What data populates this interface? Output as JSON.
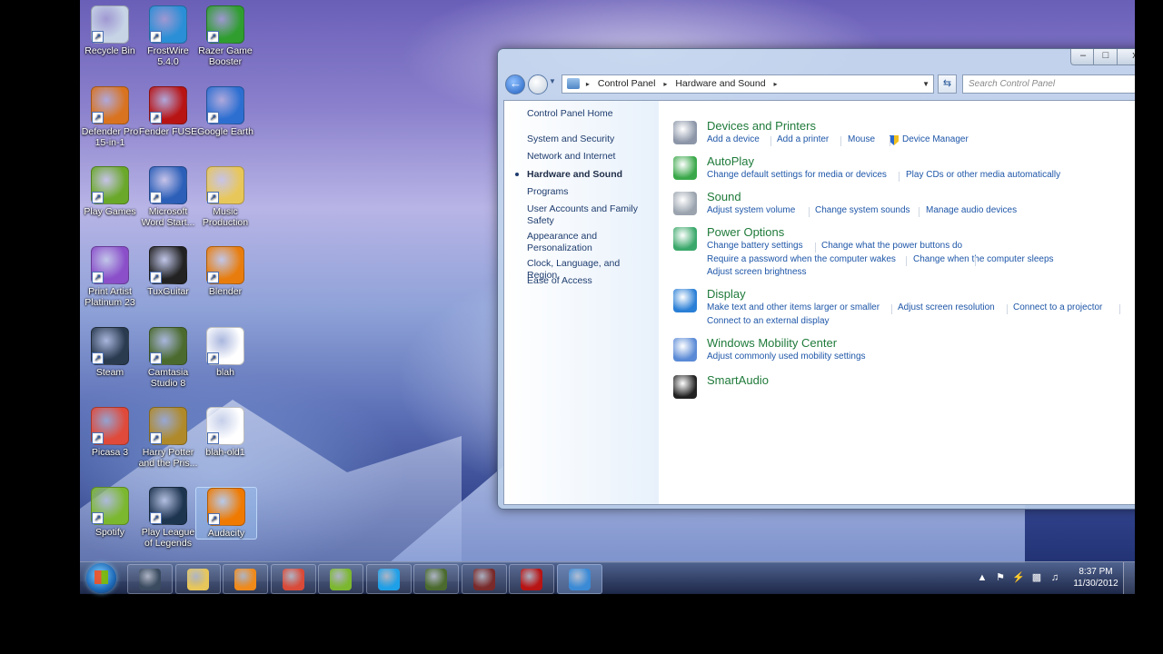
{
  "desktop": {
    "icons": [
      {
        "label": "Recycle Bin",
        "icon": "recycle-bin-icon",
        "color": "#c7d4e6"
      },
      {
        "label": "FrostWire 5.4.0",
        "icon": "frostwire-icon",
        "color": "#2a8fd6"
      },
      {
        "label": "Razer Game Booster",
        "icon": "razer-icon",
        "color": "#2f9e2f"
      },
      {
        "label": "Defender Pro 15-in-1",
        "icon": "defender-icon",
        "color": "#d9731f"
      },
      {
        "label": "Fender FUSE",
        "icon": "fender-icon",
        "color": "#b81414"
      },
      {
        "label": "Google Earth",
        "icon": "google-earth-icon",
        "color": "#2c6fd1"
      },
      {
        "label": "Play Games",
        "icon": "wildtangent-icon",
        "color": "#6aa82a"
      },
      {
        "label": "Microsoft Word Start...",
        "icon": "word-icon",
        "color": "#2b5fb8"
      },
      {
        "label": "Music Production",
        "icon": "folder-icon",
        "color": "#e8c75a"
      },
      {
        "label": "Print Artist Platinum 23",
        "icon": "print-artist-icon",
        "color": "#8a4fc9"
      },
      {
        "label": "TuxGuitar",
        "icon": "tux-icon",
        "color": "#222222"
      },
      {
        "label": "Blender",
        "icon": "blender-icon",
        "color": "#e87d0d"
      },
      {
        "label": "Steam",
        "icon": "steam-icon",
        "color": "#2a3a4f"
      },
      {
        "label": "Camtasia Studio 8",
        "icon": "camtasia-icon",
        "color": "#4b6b2e"
      },
      {
        "label": "blah",
        "icon": "wav-file-icon",
        "color": "#ffffff"
      },
      {
        "label": "Picasa 3",
        "icon": "picasa-icon",
        "color": "#e04a3a"
      },
      {
        "label": "Harry Potter and the Pris...",
        "icon": "harry-potter-icon",
        "color": "#b08a2a"
      },
      {
        "label": "blah-old1",
        "icon": "wav-file-icon",
        "color": "#ffffff"
      },
      {
        "label": "Spotify",
        "icon": "spotify-icon",
        "color": "#7cb82f"
      },
      {
        "label": "Play League of Legends",
        "icon": "league-icon",
        "color": "#1e3550"
      },
      {
        "label": "Audacity",
        "icon": "audacity-icon",
        "color": "#f07a00"
      }
    ]
  },
  "window": {
    "controls": {
      "minimize": "–",
      "maximize": "□",
      "close": "x"
    },
    "address": {
      "root": "Control Panel",
      "current": "Hardware and Sound",
      "sep": "▸"
    },
    "search_placeholder": "Search Control Panel",
    "sidebar": {
      "items": [
        {
          "label": "Control Panel Home"
        },
        {
          "label": "System and Security"
        },
        {
          "label": "Network and Internet"
        },
        {
          "label": "Hardware and Sound"
        },
        {
          "label": "Programs"
        },
        {
          "label": "User Accounts and Family Safety"
        },
        {
          "label": "Appearance and Personalization"
        },
        {
          "label": "Clock, Language, and Region"
        },
        {
          "label": "Ease of Access"
        }
      ]
    },
    "categories": [
      {
        "title": "Devices and Printers",
        "icon": "devices-printers-icon",
        "links": [
          "Add a device",
          "Add a printer",
          "Mouse",
          "Device Manager"
        ]
      },
      {
        "title": "AutoPlay",
        "icon": "autoplay-icon",
        "links": [
          "Change default settings for media or devices",
          "Play CDs or other media automatically"
        ]
      },
      {
        "title": "Sound",
        "icon": "speaker-icon",
        "links": [
          "Adjust system volume",
          "Change system sounds",
          "Manage audio devices"
        ]
      },
      {
        "title": "Power Options",
        "icon": "power-options-icon",
        "links": [
          "Change battery settings",
          "Change what the power buttons do",
          "Require a password when the computer wakes",
          "Change when the computer sleeps",
          "Adjust screen brightness"
        ]
      },
      {
        "title": "Display",
        "icon": "display-icon",
        "links": [
          "Make text and other items larger or smaller",
          "Adjust screen resolution",
          "Connect to a projector",
          "Connect to an external display"
        ]
      },
      {
        "title": "Windows Mobility Center",
        "icon": "mobility-center-icon",
        "links": [
          "Adjust commonly used mobility settings"
        ]
      },
      {
        "title": "SmartAudio",
        "icon": "smartaudio-icon",
        "links": []
      }
    ]
  },
  "taskbar": {
    "buttons": [
      {
        "name": "steam",
        "icon": "steam-icon",
        "color": "#3a4a5f"
      },
      {
        "name": "explorer",
        "icon": "folder-icon",
        "color": "#e8c75a"
      },
      {
        "name": "media",
        "icon": "media-player-icon",
        "color": "#f08a1a"
      },
      {
        "name": "chrome",
        "icon": "chrome-icon",
        "color": "#d94a38"
      },
      {
        "name": "spotify",
        "icon": "spotify-icon",
        "color": "#7cb82f"
      },
      {
        "name": "skype",
        "icon": "skype-icon",
        "color": "#1ea0e8"
      },
      {
        "name": "camtasia",
        "icon": "camtasia-icon",
        "color": "#4b6b2e"
      },
      {
        "name": "recorder",
        "icon": "camtasia-recorder-icon",
        "color": "#7a2a2a"
      },
      {
        "name": "fender",
        "icon": "fender-icon",
        "color": "#b81414"
      },
      {
        "name": "control-panel",
        "icon": "control-panel-icon",
        "color": "#3a8ad6"
      }
    ],
    "clock": {
      "time": "8:37 PM",
      "date": "11/30/2012"
    }
  }
}
